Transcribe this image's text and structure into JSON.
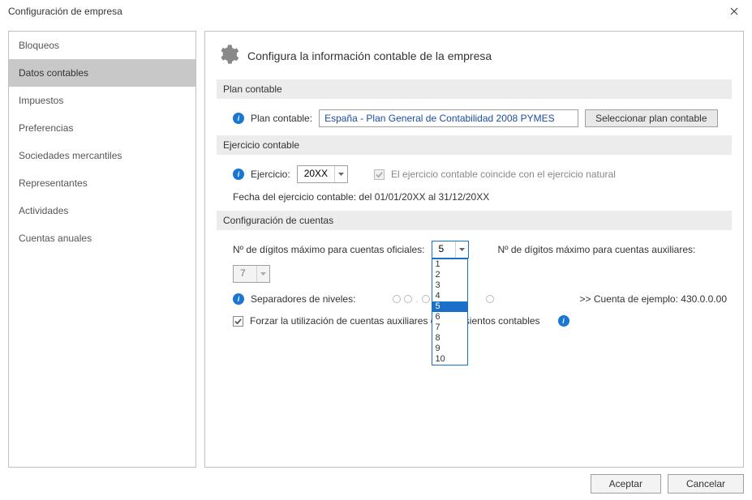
{
  "window": {
    "title": "Configuración de empresa"
  },
  "sidebar": {
    "items": [
      {
        "label": "Bloqueos"
      },
      {
        "label": "Datos contables"
      },
      {
        "label": "Impuestos"
      },
      {
        "label": "Preferencias"
      },
      {
        "label": "Sociedades mercantiles"
      },
      {
        "label": "Representantes"
      },
      {
        "label": "Actividades"
      },
      {
        "label": "Cuentas anuales"
      }
    ],
    "active_index": 1
  },
  "header": {
    "title": "Configura la información contable de la empresa"
  },
  "plan": {
    "section": "Plan contable",
    "label": "Plan contable:",
    "value": "España - Plan General de Contabilidad 2008 PYMES",
    "select_btn": "Seleccionar plan contable"
  },
  "ejercicio": {
    "section": "Ejercicio contable",
    "label": "Ejercicio:",
    "value": "20XX",
    "coincide_label": "El ejercicio contable coincide con el ejercicio natural",
    "fecha_label": "Fecha del ejercicio contable: del 01/01/20XX al 31/12/20XX"
  },
  "cuentas": {
    "section": "Configuración de cuentas",
    "oficiales_label": "Nº de dígitos máximo para cuentas oficiales:",
    "oficiales_value": "5",
    "oficiales_options": [
      "1",
      "2",
      "3",
      "4",
      "5",
      "6",
      "7",
      "8",
      "9",
      "10"
    ],
    "aux_label": "Nº de dígitos máximo para cuentas auxiliares:",
    "aux_value": "7",
    "sep_label": "Separadores de niveles:",
    "ejemplo_label": ">> Cuenta de ejemplo: 430.0.0.00",
    "forzar_label": "Forzar la utilización de cuentas auxiliares en los asientos contables"
  },
  "footer": {
    "ok": "Aceptar",
    "cancel": "Cancelar"
  }
}
